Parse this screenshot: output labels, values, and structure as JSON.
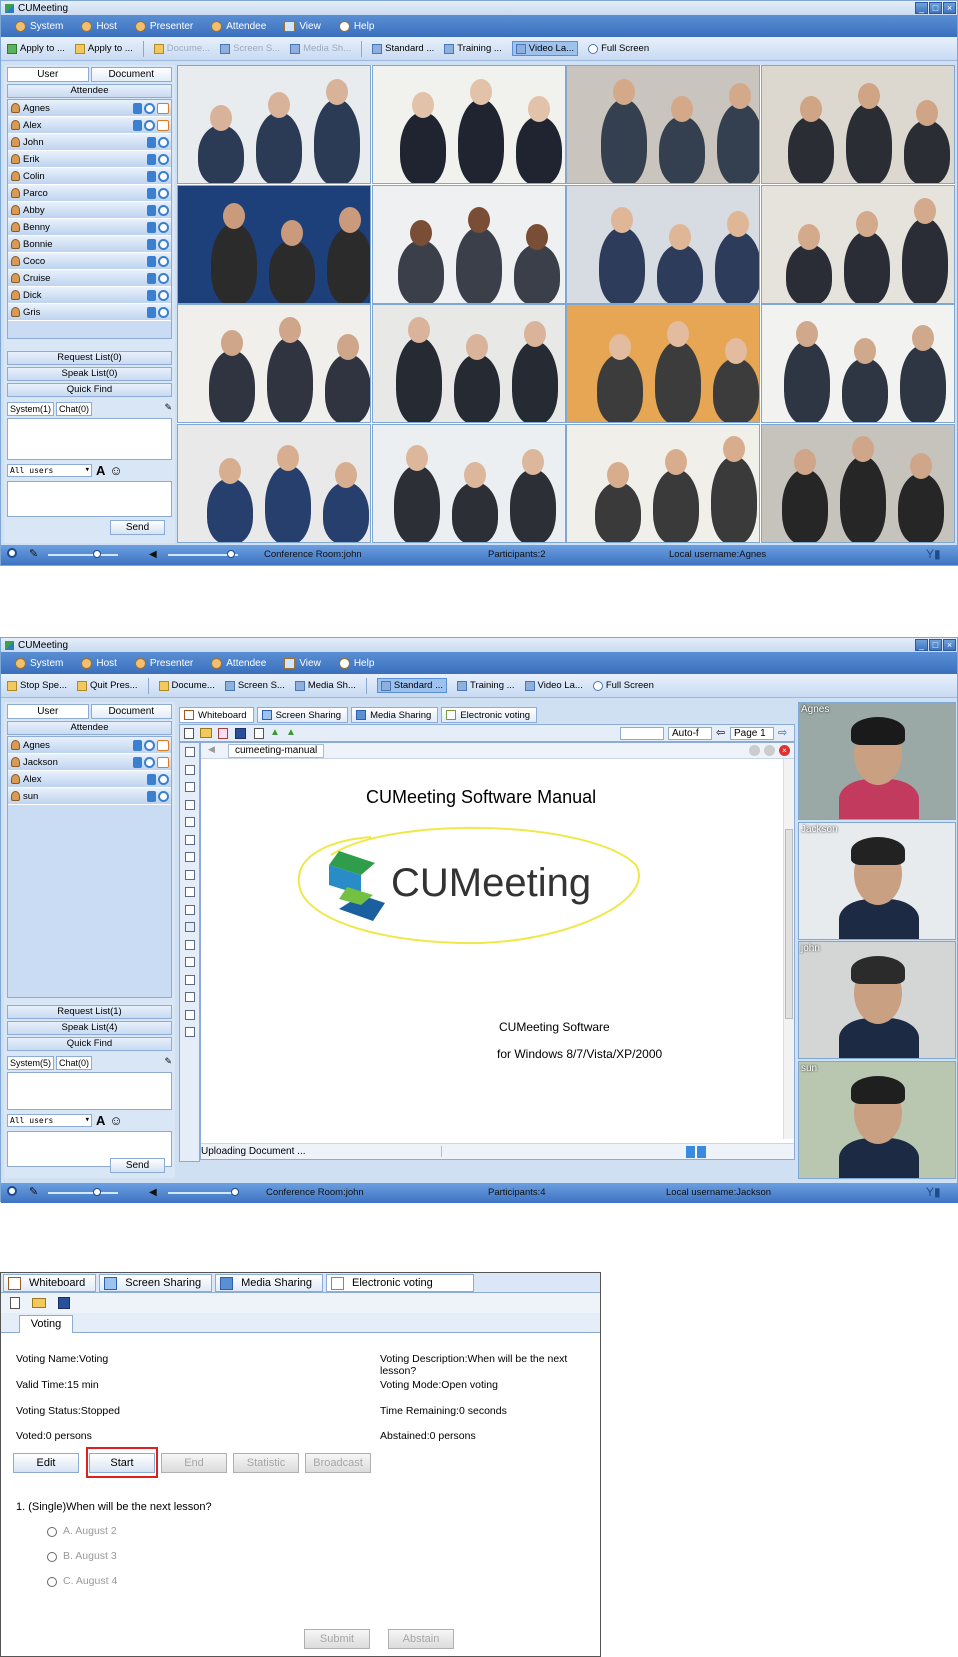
{
  "app_title": "CUMeeting",
  "menu": [
    "System",
    "Host",
    "Presenter",
    "Attendee",
    "View",
    "Help"
  ],
  "window1": {
    "toolbar": [
      "Apply to ...",
      "Apply to ...",
      "Docume...",
      "Screen S...",
      "Media Sh...",
      "Standard ...",
      "Training ...",
      "Video La...",
      "Full Screen"
    ],
    "tabs": [
      "User",
      "Document"
    ],
    "attendee_header": "Attendee",
    "users": [
      "Agnes",
      "Alex",
      "John",
      "Erik",
      "Colin",
      "Parco",
      "Abby",
      "Benny",
      "Bonnie",
      "Coco",
      "Cruise",
      "Dick",
      "Gris"
    ],
    "request_list": "Request List(0)",
    "speak_list": "Speak List(0)",
    "quick_find": "Quick Find",
    "chat_tabs": [
      "System(1)",
      "Chat(0)"
    ],
    "all_users": "All users",
    "send": "Send",
    "status": {
      "room": "Conference Room:john",
      "participants": "Participants:2",
      "local_user": "Local username:Agnes"
    },
    "volume_levels": {
      "mic": 0.7,
      "speaker": 0.9
    }
  },
  "window2": {
    "toolbar": [
      "Stop Spe...",
      "Quit Pres...",
      "Docume...",
      "Screen S...",
      "Media Sh...",
      "Standard ...",
      "Training ...",
      "Video La...",
      "Full Screen"
    ],
    "tabs": [
      "User",
      "Document"
    ],
    "attendee_header": "Attendee",
    "users": [
      "Agnes",
      "Jackson",
      "Alex",
      "sun"
    ],
    "request_list": "Request List(1)",
    "speak_list": "Speak List(4)",
    "quick_find": "Quick Find",
    "chat_tabs": [
      "System(5)",
      "Chat(0)"
    ],
    "all_users": "All users",
    "send": "Send",
    "wb_tabs": [
      "Whiteboard",
      "Screen Sharing",
      "Media Sharing",
      "Electronic voting"
    ],
    "zoom": "Auto-f",
    "page": "Page 1",
    "doc_tab": "cumeeting-manual",
    "doc_title": "CUMeeting Software Manual",
    "logo_text": "CUMeeting",
    "doc_line1": "CUMeeting Software",
    "doc_line2": "for Windows 8/7/Vista/XP/2000",
    "upload_status": "Uploading Document ...",
    "video_labels": [
      "Agnes",
      "Jackson",
      "john",
      "sun"
    ],
    "status": {
      "room": "Conference Room:john",
      "participants": "Participants:4",
      "local_user": "Local username:Jackson"
    },
    "volume_levels": {
      "mic": 0.7,
      "speaker": 0.95
    }
  },
  "voting": {
    "tabs": [
      "Whiteboard",
      "Screen Sharing",
      "Media Sharing",
      "Electronic voting"
    ],
    "subtab": "Voting",
    "name": "Voting Name:Voting",
    "description": "Voting Description:When will be the next lesson?",
    "valid_time": "Valid Time:15 min",
    "mode": "Voting Mode:Open voting",
    "status": "Voting Status:Stopped",
    "remaining": "Time Remaining:0 seconds",
    "voted": "Voted:0 persons",
    "abstained": "Abstained:0 persons",
    "buttons": [
      "Edit",
      "Start",
      "End",
      "Statistic",
      "Broadcast"
    ],
    "question": "1. (Single)When will be the next lesson?",
    "options": [
      "A. August 2",
      "B. August 3",
      "C. August 4"
    ],
    "submit": "Submit",
    "abstain": "Abstain",
    "highlight_color": "#e02020"
  }
}
